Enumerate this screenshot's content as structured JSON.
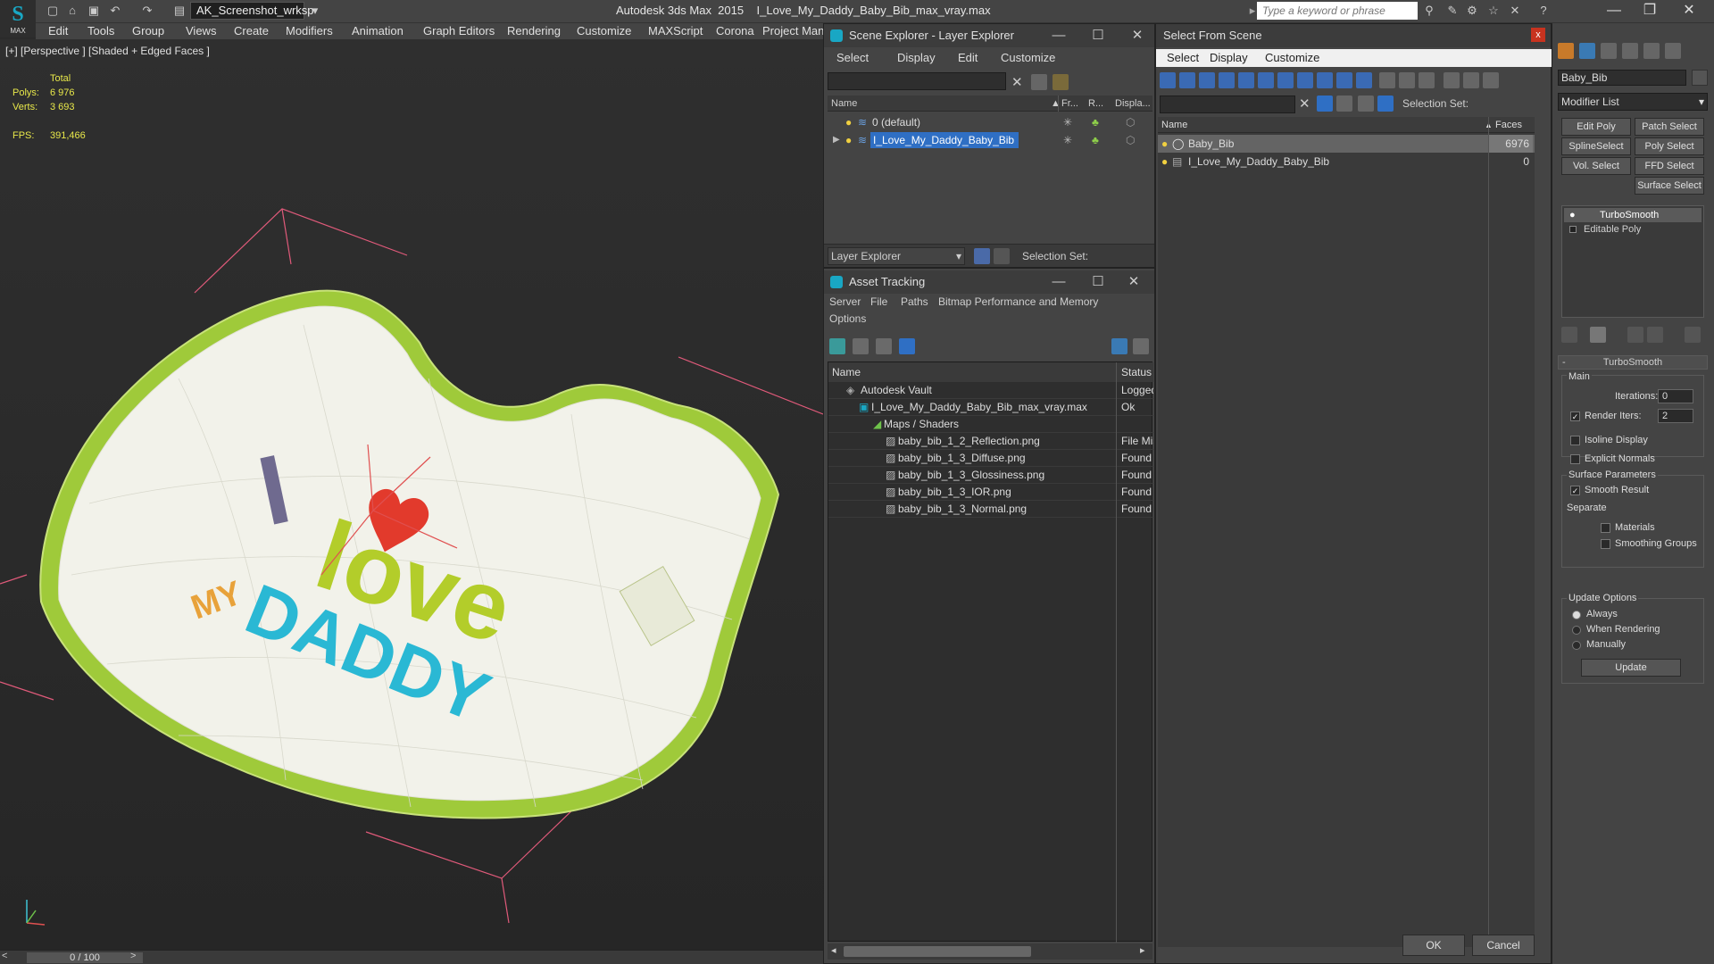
{
  "app": {
    "title": "Autodesk 3ds Max  2015    I_Love_My_Daddy_Baby_Bib_max_vray.max",
    "workspace": "AK_Screenshot_wrksp",
    "search_placeholder": "Type a keyword or phrase",
    "logo_text": "MAX"
  },
  "menubar": [
    "Edit",
    "Tools",
    "Group",
    "Views",
    "Create",
    "Modifiers",
    "Animation",
    "Graph Editors",
    "Rendering",
    "Customize",
    "MAXScript",
    "Corona",
    "Project Man"
  ],
  "viewport": {
    "label": "[+] [Perspective ] [Shaded + Edged Faces ]",
    "stats": {
      "total_label": "Total",
      "polys_label": "Polys:",
      "polys": "6 976",
      "verts_label": "Verts:",
      "verts": "3 693",
      "fps_label": "FPS:",
      "fps": "391,466"
    },
    "bib_text": {
      "i": "I",
      "love": "love",
      "my": "MY",
      "daddy": "DADDY"
    }
  },
  "timeline": {
    "frame": "0 / 100",
    "prev": "<",
    "next": ">"
  },
  "scene_explorer": {
    "title": "Scene Explorer - Layer Explorer",
    "menu": [
      "Select",
      "Display",
      "Edit",
      "Customize"
    ],
    "columns": [
      "Name",
      "Fr...",
      "R...",
      "Displa..."
    ],
    "layers": [
      "0 (default)",
      "I_Love_My_Daddy_Baby_Bib"
    ],
    "footer_dropdown": "Layer Explorer",
    "selection_set_label": "Selection Set:"
  },
  "asset_tracking": {
    "title": "Asset Tracking",
    "menu": [
      "Server",
      "File",
      "Paths",
      "Bitmap Performance and Memory",
      "Options"
    ],
    "columns": [
      "Name",
      "Status"
    ],
    "rows": [
      {
        "name": "Autodesk Vault",
        "status": "Logged"
      },
      {
        "name": "I_Love_My_Daddy_Baby_Bib_max_vray.max",
        "status": "Ok"
      },
      {
        "name": "Maps / Shaders",
        "status": ""
      },
      {
        "name": "baby_bib_1_2_Reflection.png",
        "status": "File Mis"
      },
      {
        "name": "baby_bib_1_3_Diffuse.png",
        "status": "Found"
      },
      {
        "name": "baby_bib_1_3_Glossiness.png",
        "status": "Found"
      },
      {
        "name": "baby_bib_1_3_IOR.png",
        "status": "Found"
      },
      {
        "name": "baby_bib_1_3_Normal.png",
        "status": "Found"
      }
    ]
  },
  "select_from_scene": {
    "title": "Select From Scene",
    "close": "x",
    "menu": [
      "Select",
      "Display",
      "Customize"
    ],
    "selection_set_label": "Selection Set:",
    "columns": [
      "Name",
      "Faces"
    ],
    "rows": [
      {
        "name": "Baby_Bib",
        "faces": "6976"
      },
      {
        "name": "I_Love_My_Daddy_Baby_Bib",
        "faces": "0"
      }
    ],
    "ok": "OK",
    "cancel": "Cancel"
  },
  "command_panel": {
    "object_name": "Baby_Bib",
    "modifier_list": "Modifier List",
    "buttons": [
      "Edit Poly",
      "Patch Select",
      "SplineSelect",
      "Poly Select",
      "Vol. Select",
      "FFD Select",
      "Surface Select"
    ],
    "stack": [
      "TurboSmooth",
      "Editable Poly"
    ],
    "rollout_title": "TurboSmooth",
    "main_label": "Main",
    "iterations_label": "Iterations:",
    "iterations": "0",
    "render_iters_label": "Render Iters:",
    "render_iters": "2",
    "isoline": "Isoline Display",
    "explicit_normals": "Explicit Normals",
    "surface_params": "Surface Parameters",
    "smooth_result": "Smooth Result",
    "separate": "Separate",
    "materials": "Materials",
    "smoothing_groups": "Smoothing Groups",
    "update_options": "Update Options",
    "always": "Always",
    "when_rendering": "When Rendering",
    "manually": "Manually",
    "update": "Update"
  }
}
